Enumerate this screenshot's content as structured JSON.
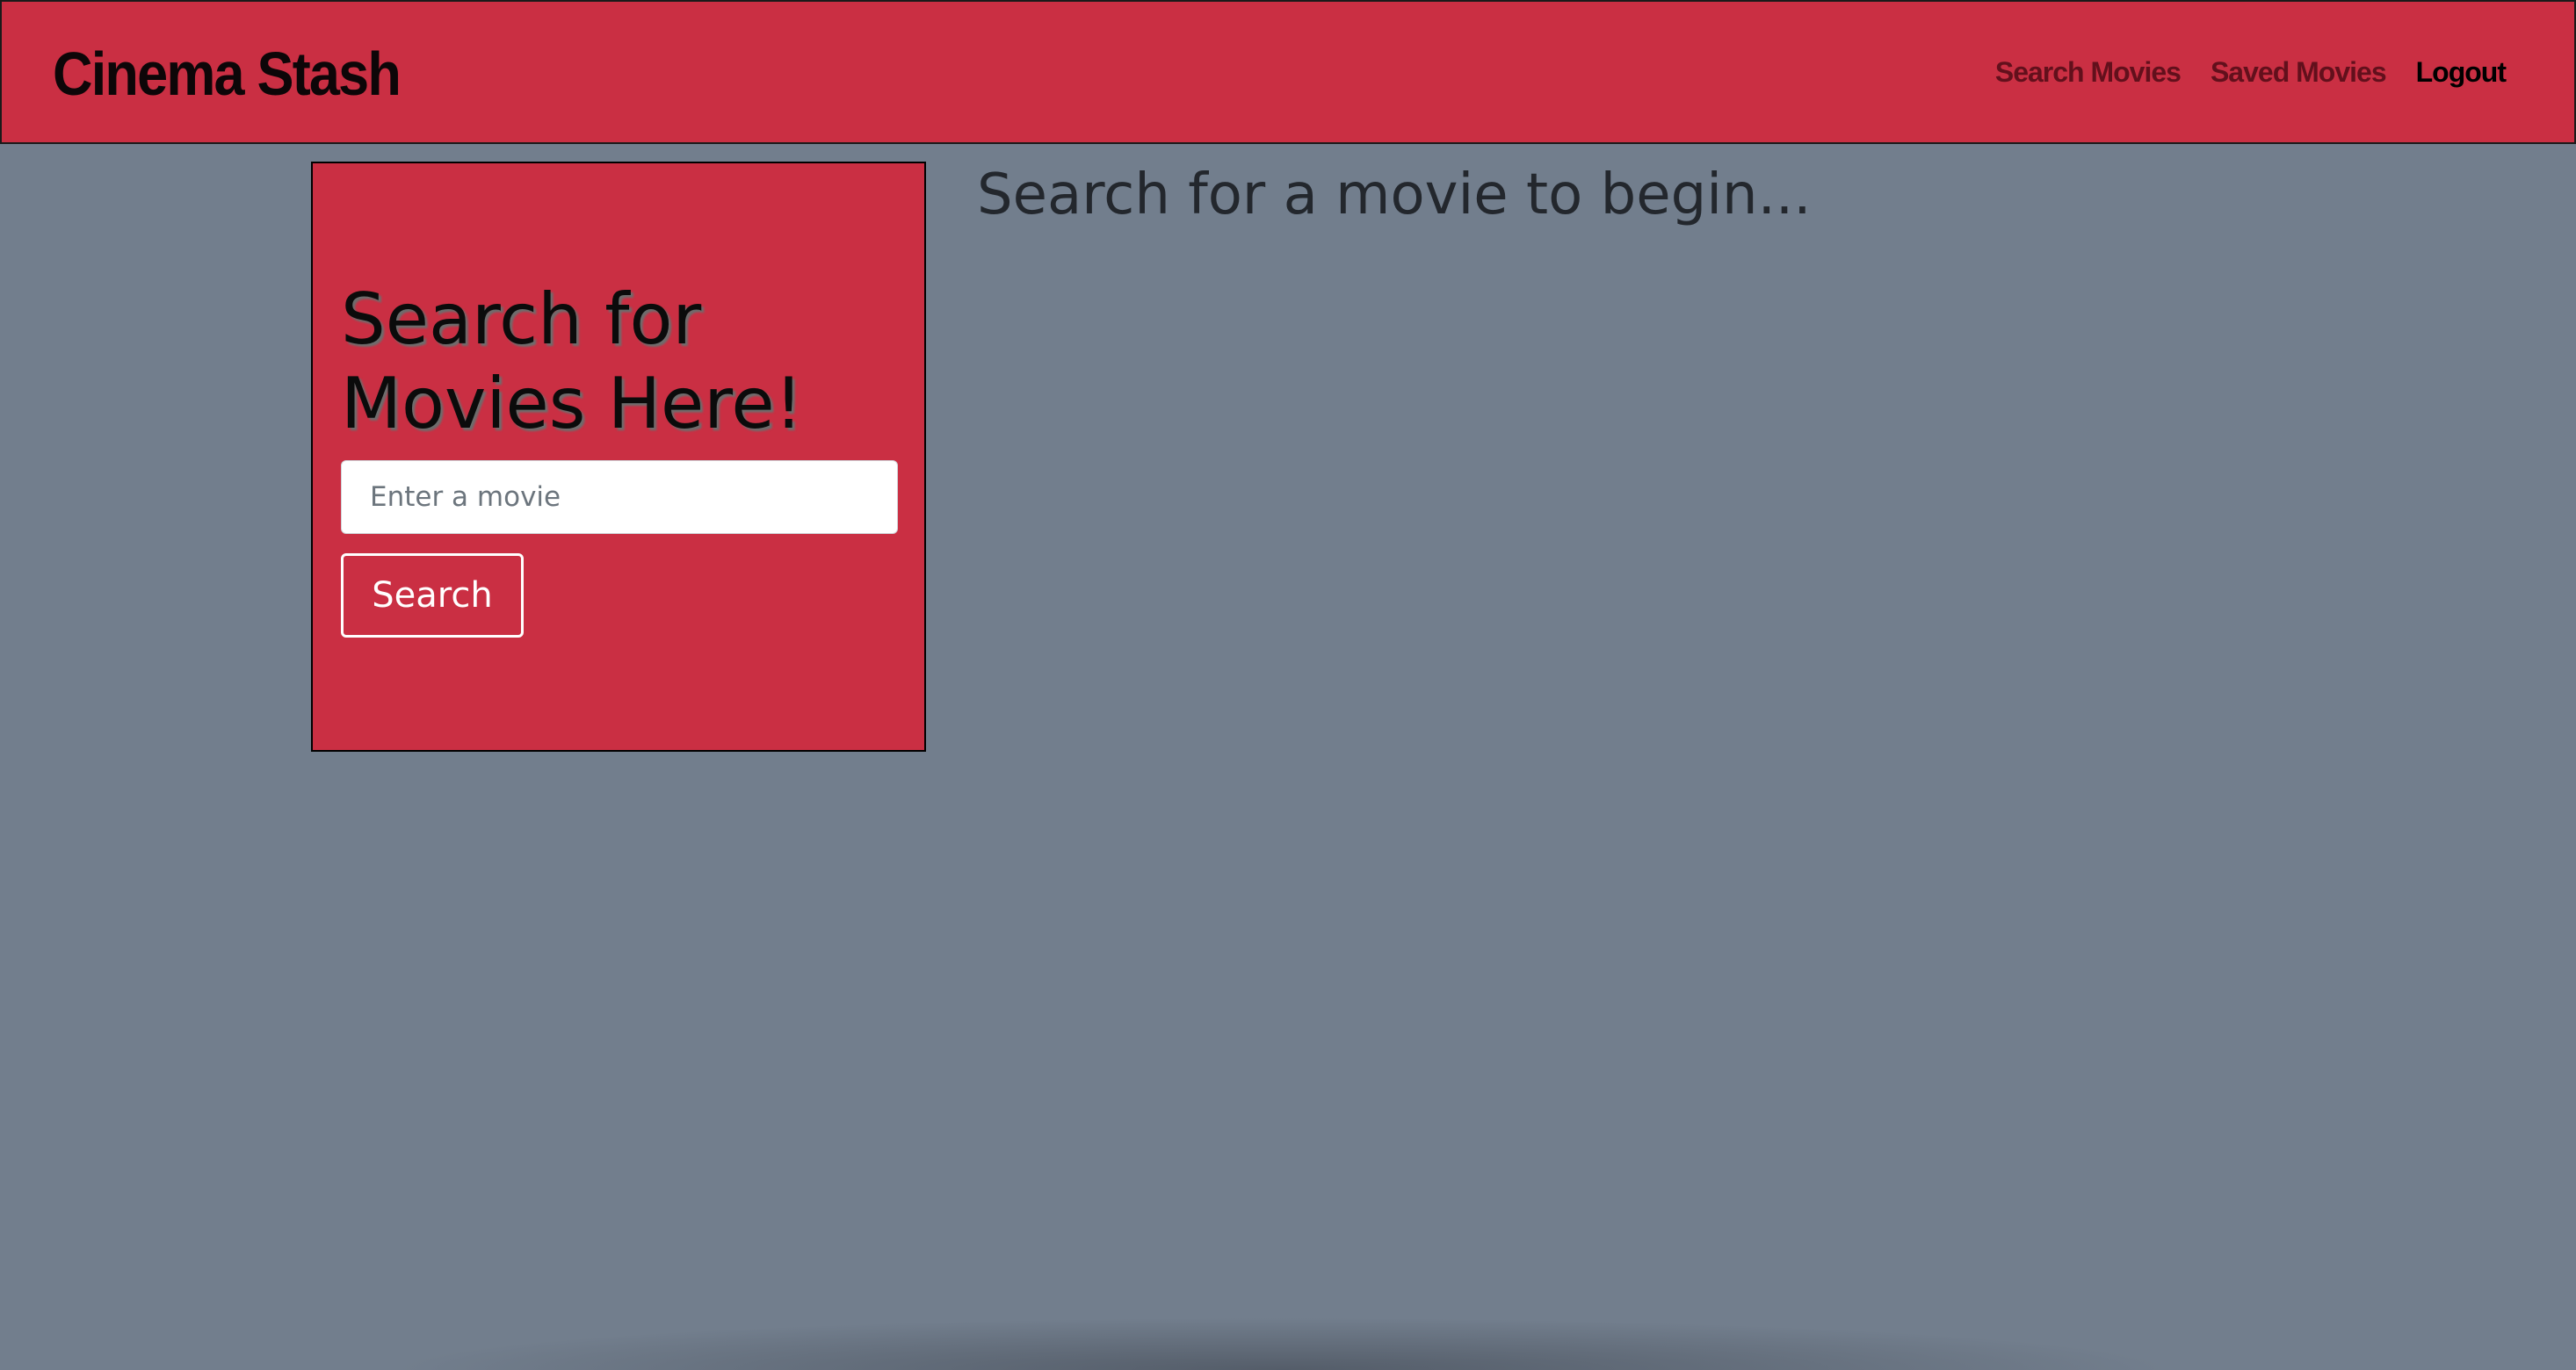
{
  "navbar": {
    "brand": "Cinema Stash",
    "links": [
      {
        "label": "Search Movies"
      },
      {
        "label": "Saved Movies"
      },
      {
        "label": "Logout"
      }
    ]
  },
  "search_panel": {
    "heading": "Search for Movies Here!",
    "input": {
      "placeholder": "Enter a movie",
      "value": ""
    },
    "button_label": "Search"
  },
  "main": {
    "empty_message": "Search for a movie to begin..."
  },
  "colors": {
    "background": "#727e8d",
    "accent_red": "#ca2f43",
    "nav_link_inactive": "#62101c",
    "nav_link_active": "#000000"
  }
}
